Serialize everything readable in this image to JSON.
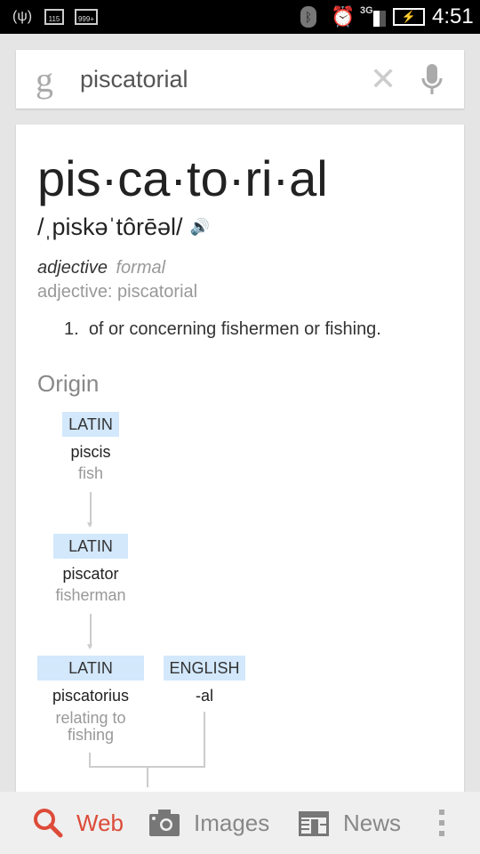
{
  "status_bar": {
    "time": "4:51",
    "mail_count_1": "115",
    "mail_count_2": "999+",
    "network": "3G"
  },
  "search": {
    "query": "piscatorial",
    "logo": "g"
  },
  "definition": {
    "headword": "pis·ca·to·ri·al",
    "pronunciation": "/ˌpiskəˈtôrēəl/",
    "part_of_speech": "adjective",
    "register": "formal",
    "form_line": "adjective: piscatorial",
    "senses": [
      {
        "number": "1.",
        "text": "of or concerning fishermen or fishing."
      }
    ]
  },
  "origin": {
    "title": "Origin",
    "nodes": [
      {
        "language": "LATIN",
        "word": "piscis",
        "gloss": "fish"
      },
      {
        "language": "LATIN",
        "word": "piscator",
        "gloss": "fisherman"
      },
      {
        "language": "LATIN",
        "word": "piscatorius",
        "gloss_1": "relating to",
        "gloss_2": "fishing"
      },
      {
        "language": "ENGLISH",
        "word": "-al"
      }
    ]
  },
  "bottom_nav": {
    "items": [
      {
        "label": "Web",
        "active": true
      },
      {
        "label": "Images"
      },
      {
        "label": "News"
      }
    ]
  },
  "colors": {
    "accent": "#dd4b39",
    "tag_bg": "#d3e8fb"
  }
}
